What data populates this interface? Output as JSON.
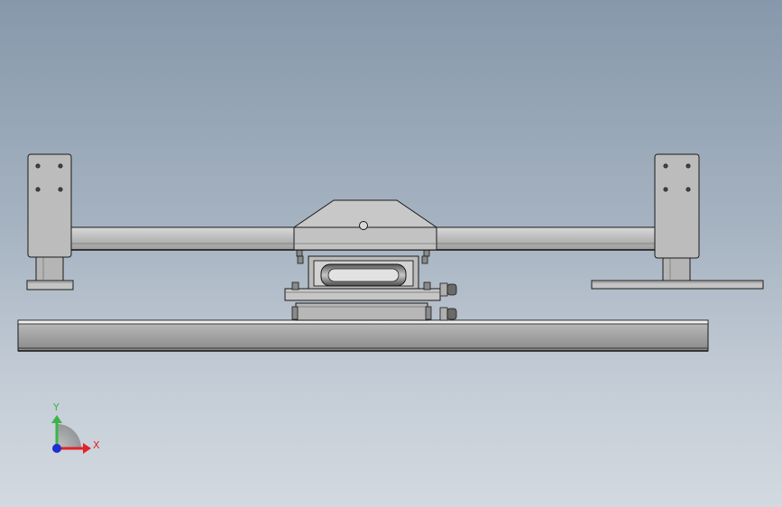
{
  "colors": {
    "metal_light": "#c9c9c9",
    "metal_mid": "#a9a9a9",
    "metal_dark": "#7e7e7e",
    "edge": "#1a1a1a",
    "axis_x": "#e0232b",
    "axis_y": "#3bb54a",
    "axis_z": "#1d2fd1"
  },
  "triad": {
    "x_label": "X",
    "y_label": "Y"
  }
}
